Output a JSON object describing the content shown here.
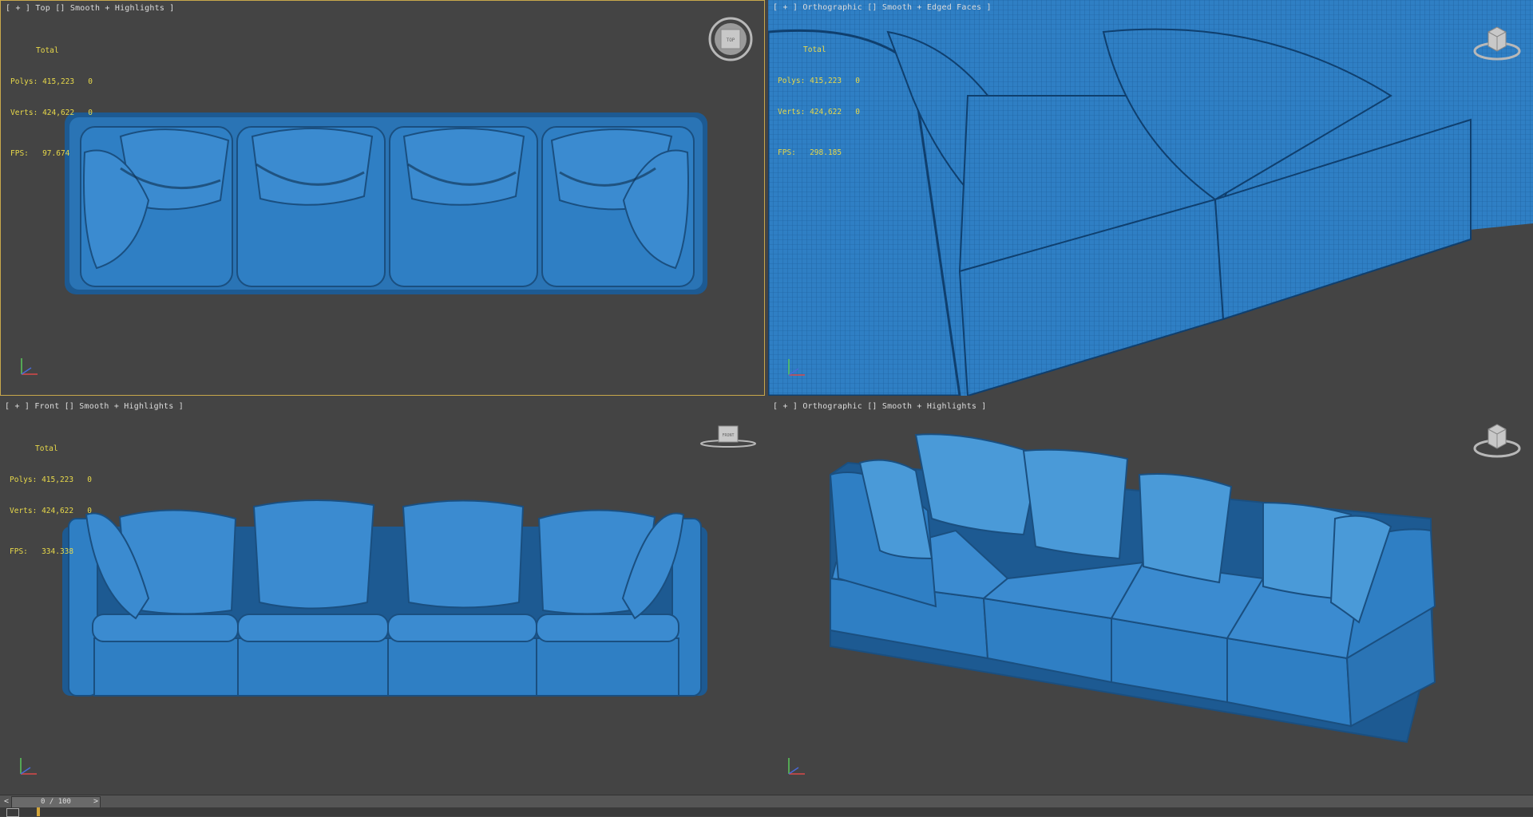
{
  "viewports": {
    "top": {
      "label": "[ + ] Top [] Smooth + Highlights ]",
      "stats": {
        "header": "Total",
        "polys_label": "Polys:",
        "polys_value": "415,223",
        "polys_sel": "0",
        "verts_label": "Verts:",
        "verts_value": "424,622",
        "verts_sel": "0",
        "fps_label": "FPS:",
        "fps_value": "97.674"
      },
      "cube_label": "TOP"
    },
    "persp_wire": {
      "label": "[ + ] Orthographic [] Smooth + Edged Faces ]",
      "stats": {
        "header": "Total",
        "polys_label": "Polys:",
        "polys_value": "415,223",
        "polys_sel": "0",
        "verts_label": "Verts:",
        "verts_value": "424,622",
        "verts_sel": "0",
        "fps_label": "FPS:",
        "fps_value": "298.185"
      }
    },
    "front": {
      "label": "[ + ] Front [] Smooth + Highlights ]",
      "stats": {
        "header": "Total",
        "polys_label": "Polys:",
        "polys_value": "415,223",
        "polys_sel": "0",
        "verts_label": "Verts:",
        "verts_value": "424,622",
        "verts_sel": "0",
        "fps_label": "FPS:",
        "fps_value": "334.338"
      },
      "cube_label": "FRONT"
    },
    "persp": {
      "label": "[ + ] Orthographic [] Smooth + Highlights ]"
    }
  },
  "timeline": {
    "left_arrow": "<",
    "frame": "0 / 100",
    "right_arrow": ">"
  },
  "colors": {
    "sofa": "#2f7fc4",
    "sofa_dark": "#1d5a92",
    "sofa_light": "#4a9ad8",
    "viewport_bg": "#444444",
    "active_border": "#c8a84b",
    "stats_text": "#e8d94a"
  }
}
